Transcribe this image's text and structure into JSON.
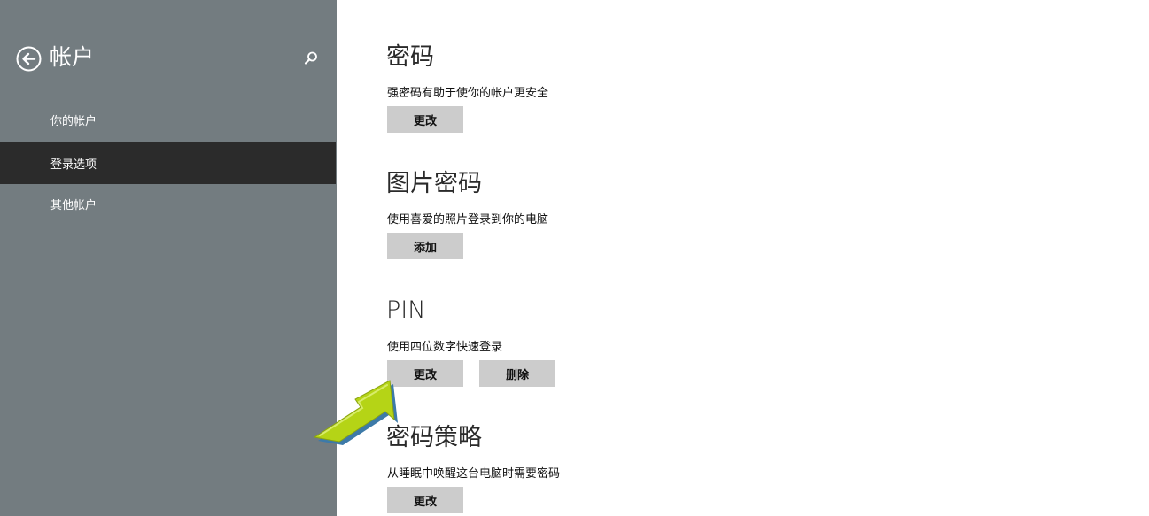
{
  "sidebar": {
    "title": "帐户",
    "items": [
      {
        "label": "你的帐户",
        "selected": false
      },
      {
        "label": "登录选项",
        "selected": true
      },
      {
        "label": "其他帐户",
        "selected": false
      }
    ],
    "icons": {
      "back": "back-arrow-circle-icon",
      "search": "search-icon"
    }
  },
  "sections": [
    {
      "title": "密码",
      "description": "强密码有助于使你的帐户更安全",
      "buttons": [
        "更改"
      ]
    },
    {
      "title": "图片密码",
      "description": "使用喜爱的照片登录到你的电脑",
      "buttons": [
        "添加"
      ]
    },
    {
      "title": "PIN",
      "description": "使用四位数字快速登录",
      "buttons": [
        "更改",
        "删除"
      ]
    },
    {
      "title": "密码策略",
      "description": "从睡眠中唤醒这台电脑时需要密码",
      "buttons": [
        "更改"
      ]
    }
  ],
  "colors": {
    "sidebar_bg": "#737c80",
    "selected_bg": "#2b2b2b",
    "button_bg": "#cccccc",
    "arrow_green": "#b5d416"
  }
}
